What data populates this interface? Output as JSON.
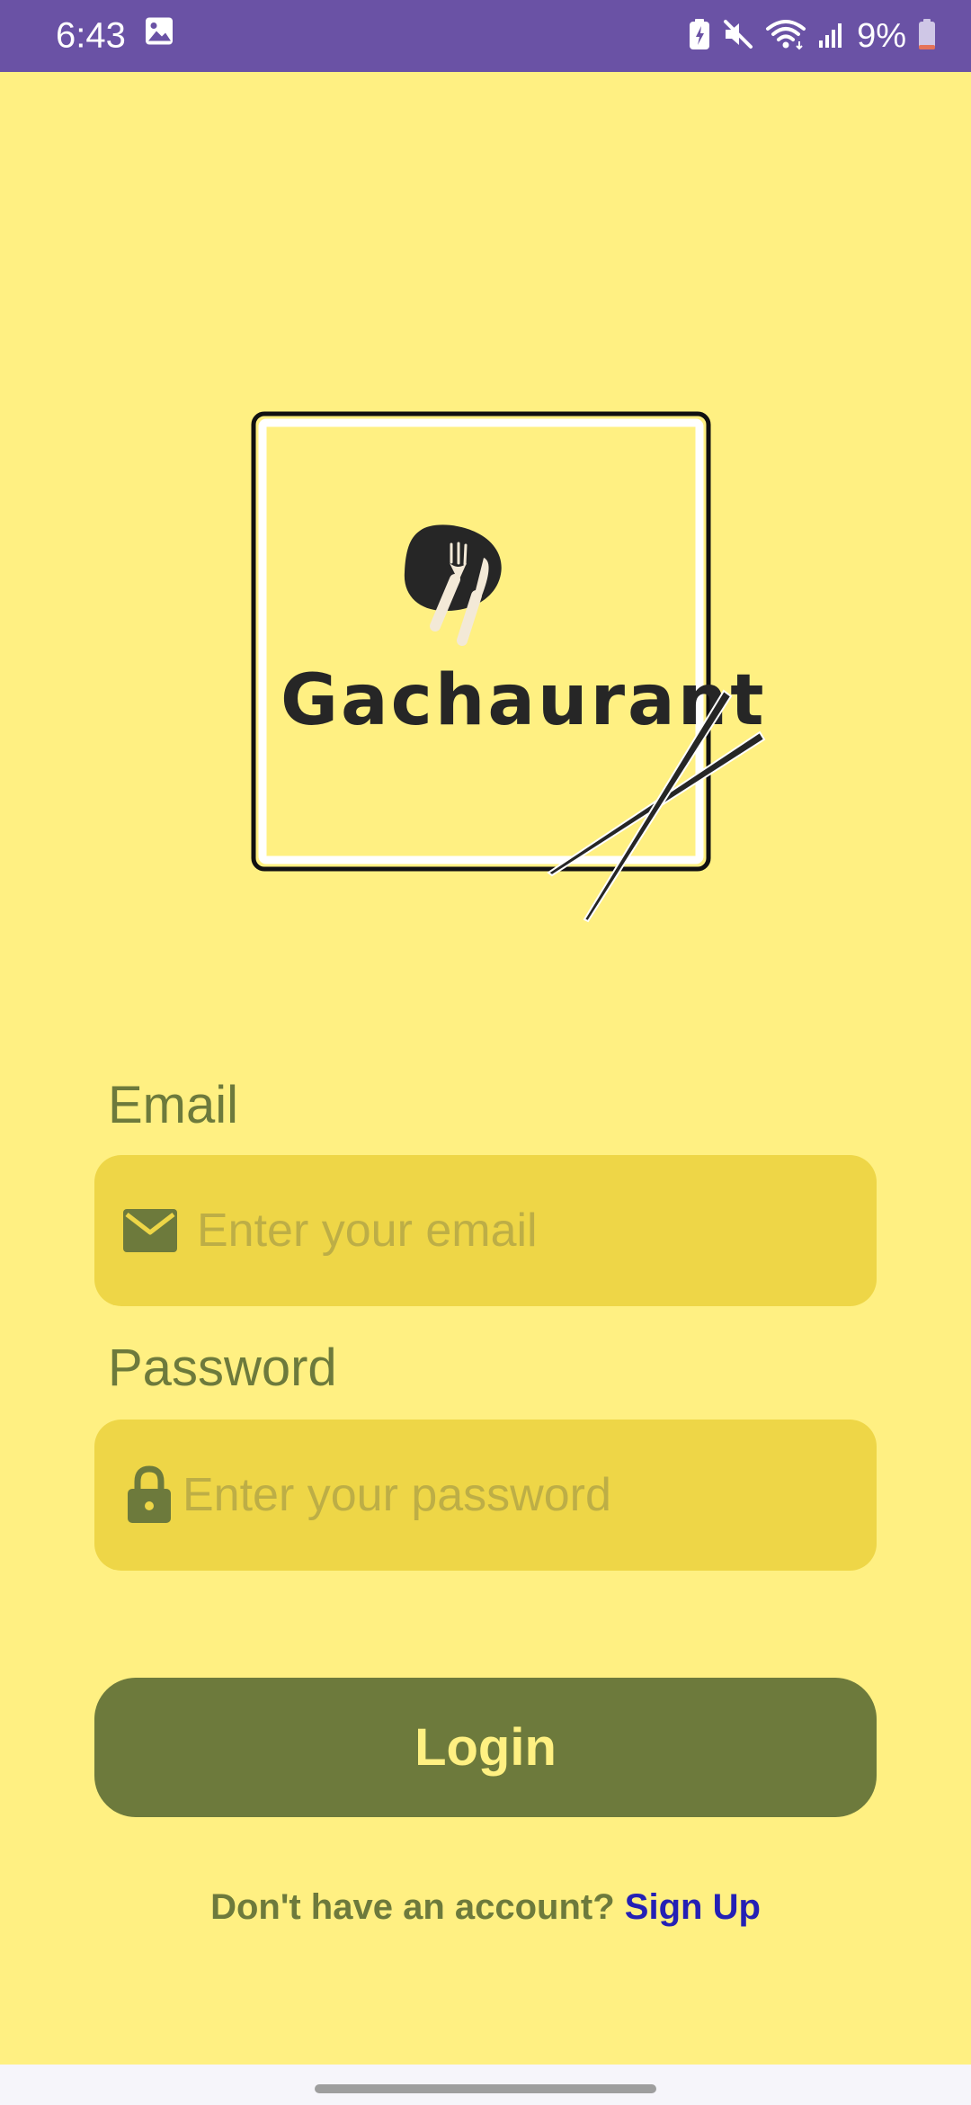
{
  "status_bar": {
    "time": "6:43",
    "battery": "9%",
    "icons": [
      "gallery-icon",
      "battery-saver-icon",
      "mute-icon",
      "wifi-icon",
      "signal-icon",
      "battery-icon"
    ],
    "background": "#6A52A5"
  },
  "logo": {
    "brand": "Gachaurant"
  },
  "form": {
    "email": {
      "label": "Email",
      "placeholder": "Enter your email",
      "icon": "email-icon"
    },
    "password": {
      "label": "Password",
      "placeholder": "Enter your password",
      "icon": "lock-icon"
    },
    "login_label": "Login"
  },
  "footer": {
    "prompt": "Don't have an account?",
    "signup_label": "Sign Up"
  },
  "colors": {
    "background": "#FFF082",
    "input_fill": "#EED647",
    "accent": "#6D7A3C",
    "link": "#2420B5"
  }
}
